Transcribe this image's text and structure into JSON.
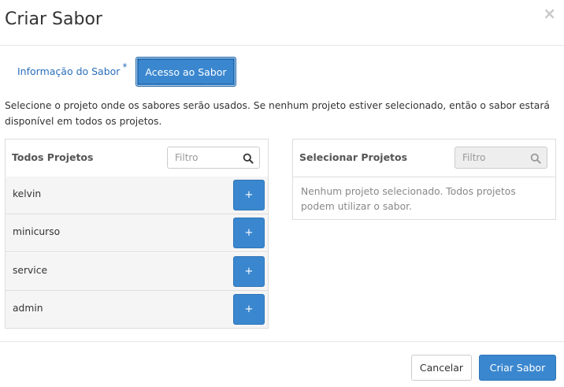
{
  "modal": {
    "title": "Criar Sabor",
    "close_label": "×"
  },
  "tabs": [
    {
      "label": "Informação do Sabor",
      "required_marker": "*",
      "active": false
    },
    {
      "label": "Acesso ao Sabor",
      "active": true
    }
  ],
  "help_text": "Selecione o projeto onde os sabores serão usados. Se nenhum projeto estiver selecionado, então o sabor estará disponível em todos os projetos.",
  "all_projects": {
    "title": "Todos Projetos",
    "filter_placeholder": "Filtro",
    "search_icon": "search-icon",
    "items": [
      {
        "label": "kelvin",
        "add_label": "+"
      },
      {
        "label": "minicurso",
        "add_label": "+"
      },
      {
        "label": "service",
        "add_label": "+"
      },
      {
        "label": "admin",
        "add_label": "+"
      }
    ]
  },
  "selected_projects": {
    "title": "Selecionar Projetos",
    "filter_placeholder": "Filtro",
    "search_icon": "search-icon",
    "empty_message": "Nenhum projeto selecionado. Todos projetos podem utilizar o sabor."
  },
  "footer": {
    "cancel_label": "Cancelar",
    "submit_label": "Criar Sabor"
  },
  "colors": {
    "primary": "#3a87cf",
    "link": "#2a6ebb"
  }
}
